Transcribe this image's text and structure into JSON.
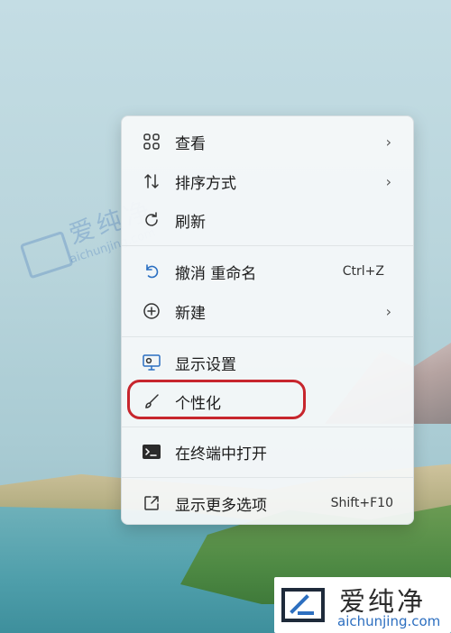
{
  "context_menu": {
    "items": [
      {
        "label": "查看",
        "icon": "view-grid-icon",
        "chevron": "›"
      },
      {
        "label": "排序方式",
        "icon": "sort-arrows-icon",
        "chevron": "›"
      },
      {
        "label": "刷新",
        "icon": "refresh-icon"
      },
      {
        "label": "撤消 重命名",
        "icon": "undo-icon",
        "shortcut": "Ctrl+Z"
      },
      {
        "label": "新建",
        "icon": "new-plus-icon",
        "chevron": "›"
      },
      {
        "label": "显示设置",
        "icon": "display-settings-icon"
      },
      {
        "label": "个性化",
        "icon": "paintbrush-icon",
        "highlighted": true
      },
      {
        "label": "在终端中打开",
        "icon": "terminal-icon"
      },
      {
        "label": "显示更多选项",
        "icon": "show-more-options-icon",
        "shortcut": "Shift+F10"
      }
    ]
  },
  "watermark": {
    "cn": "爱纯净",
    "en": "aichunjing.com"
  },
  "colors": {
    "highlight_ring": "#c7262d",
    "brand_blue": "#2d6fc0"
  }
}
